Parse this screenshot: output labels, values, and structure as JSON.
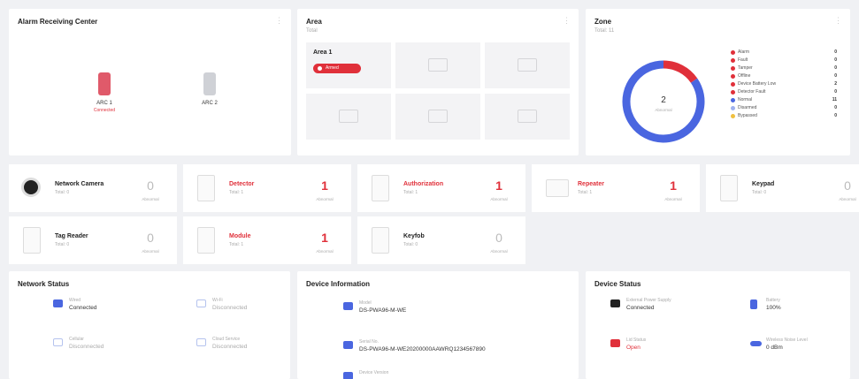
{
  "colors": {
    "accent_red": "#e0303a",
    "accent_blue": "#4a66e0",
    "background": "#f0f1f4"
  },
  "alarm_center": {
    "title": "Alarm Receiving Center",
    "controllers": [
      {
        "name": "ARC 1",
        "status": "Connected",
        "color": "#e05a6a"
      },
      {
        "name": "ARC 2",
        "status": "",
        "color": "#cfd1d6"
      }
    ]
  },
  "area": {
    "title": "Area",
    "subtitle": "Total",
    "items": [
      {
        "name": "Area 1",
        "badge": "Armed"
      }
    ]
  },
  "zone": {
    "title": "Zone",
    "subtitle": "Total: 11",
    "center_value": "2",
    "center_label": "Abnormal",
    "legend": [
      {
        "label": "Alarm",
        "value": "0",
        "color": "#e0303a"
      },
      {
        "label": "Fault",
        "value": "0",
        "color": "#e0303a"
      },
      {
        "label": "Tamper",
        "value": "0",
        "color": "#e0303a"
      },
      {
        "label": "Offline",
        "value": "0",
        "color": "#e0303a"
      },
      {
        "label": "Device Battery Low",
        "value": "2",
        "color": "#e0303a"
      },
      {
        "label": "Detector Fault",
        "value": "0",
        "color": "#e0303a"
      },
      {
        "label": "Normal",
        "value": "11",
        "color": "#4a66e0"
      },
      {
        "label": "Disarmed",
        "value": "0",
        "color": "#9fb1ef"
      },
      {
        "label": "Bypassed",
        "value": "0",
        "color": "#f0c040"
      }
    ]
  },
  "chart_data": {
    "type": "pie",
    "series": [
      {
        "name": "Abnormal",
        "values": [
          2
        ],
        "color": "#e0303a"
      },
      {
        "name": "Normal",
        "values": [
          11
        ],
        "color": "#4a66e0"
      }
    ]
  },
  "devices": [
    {
      "name": "Network Camera",
      "total": "Total: 0",
      "count": "0",
      "count_label": "Abnormal",
      "highlight": false,
      "icon": "camera-icon"
    },
    {
      "name": "Detector",
      "total": "Total: 1",
      "count": "1",
      "count_label": "Abnormal",
      "highlight": true,
      "icon": "detector-icon"
    },
    {
      "name": "Authorization",
      "total": "Total: 1",
      "count": "1",
      "count_label": "Abnormal",
      "highlight": true,
      "icon": "authorization-icon"
    },
    {
      "name": "Repeater",
      "total": "Total: 1",
      "count": "1",
      "count_label": "Abnormal",
      "highlight": true,
      "icon": "repeater-icon"
    },
    {
      "name": "Keypad",
      "total": "Total: 0",
      "count": "0",
      "count_label": "Abnormal",
      "highlight": false,
      "icon": "keypad-icon"
    },
    {
      "name": "Tag Reader",
      "total": "Total: 0",
      "count": "0",
      "count_label": "Abnormal",
      "highlight": false,
      "icon": "tag-reader-icon"
    },
    {
      "name": "Module",
      "total": "Total: 1",
      "count": "1",
      "count_label": "Abnormal",
      "highlight": true,
      "icon": "module-icon"
    },
    {
      "name": "Keyfob",
      "total": "Total: 0",
      "count": "0",
      "count_label": "Abnormal",
      "highlight": false,
      "icon": "keyfob-icon"
    }
  ],
  "network_status": {
    "title": "Network Status",
    "items": [
      {
        "label": "Wired",
        "value": "Connected",
        "faded": false,
        "icon": "wired-network-icon"
      },
      {
        "label": "Wi-Fi",
        "value": "Disconnected",
        "faded": true,
        "icon": "wifi-icon"
      },
      {
        "label": "Cellular",
        "value": "Disconnected",
        "faded": true,
        "icon": "cellular-icon"
      },
      {
        "label": "Cloud Service",
        "value": "Disconnected",
        "faded": true,
        "icon": "cloud-icon"
      }
    ]
  },
  "device_information": {
    "title": "Device Information",
    "items": [
      {
        "label": "Model",
        "value": "DS-PWA96-M-WE",
        "icon": "model-icon"
      },
      {
        "label": "Serial No.",
        "value": "DS-PWA96-M-WE20200000AAWRQ1234567890",
        "icon": "serial-icon"
      },
      {
        "label": "Device Version",
        "value": "",
        "icon": "version-icon"
      }
    ]
  },
  "device_status": {
    "title": "Device Status",
    "items": [
      {
        "label": "External Power Supply",
        "value": "Connected",
        "color": "#222222",
        "red": false,
        "icon": "power-supply-icon"
      },
      {
        "label": "Battery",
        "value": "100%",
        "color": "#4a66e0",
        "red": false,
        "icon": "battery-icon"
      },
      {
        "label": "Lid Status",
        "value": "Open",
        "color": "#e0303a",
        "red": true,
        "icon": "lid-icon"
      },
      {
        "label": "Wireless Noise Level",
        "value": "0 dBm",
        "color": "#4a66e0",
        "red": false,
        "icon": "wireless-noise-icon"
      }
    ]
  }
}
